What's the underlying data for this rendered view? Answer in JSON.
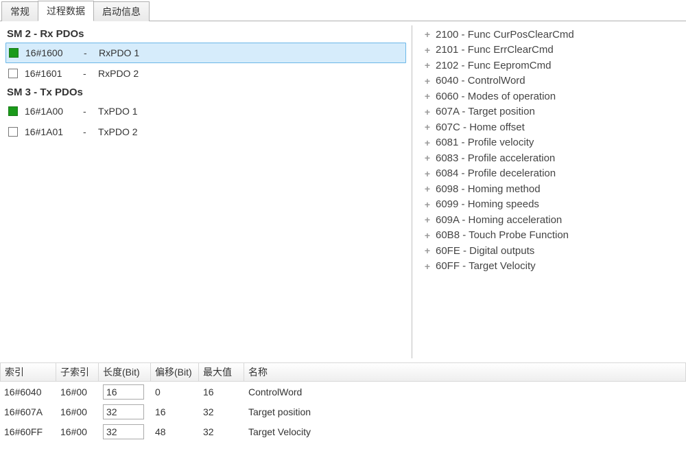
{
  "tabs": {
    "general": "常规",
    "process_data": "过程数据",
    "startup_info": "启动信息"
  },
  "active_tab": "process_data",
  "pdo_groups": [
    {
      "title": "SM 2 - Rx PDOs",
      "items": [
        {
          "checked": true,
          "selected": true,
          "index": "16#1600",
          "name": "RxPDO 1"
        },
        {
          "checked": false,
          "selected": false,
          "index": "16#1601",
          "name": "RxPDO 2"
        }
      ]
    },
    {
      "title": "SM 3 - Tx PDOs",
      "items": [
        {
          "checked": true,
          "selected": false,
          "index": "16#1A00",
          "name": "TxPDO 1"
        },
        {
          "checked": false,
          "selected": false,
          "index": "16#1A01",
          "name": "TxPDO 2"
        }
      ]
    }
  ],
  "objects": [
    "2100 - Func CurPosClearCmd",
    "2101 - Func ErrClearCmd",
    "2102 - Func EepromCmd",
    "6040 - ControlWord",
    "6060 - Modes of operation",
    "607A - Target position",
    "607C - Home offset",
    "6081 - Profile velocity",
    "6083 - Profile acceleration",
    "6084 - Profile deceleration",
    "6098 - Homing method",
    "6099 - Homing speeds",
    "609A - Homing acceleration",
    "60B8 - Touch Probe Function",
    "60FE - Digital outputs",
    "60FF - Target Velocity"
  ],
  "mapping_table": {
    "headers": {
      "index": "索引",
      "subindex": "子索引",
      "length_bit": "长度(Bit)",
      "offset_bit": "偏移(Bit)",
      "max": "最大值",
      "name": "名称"
    },
    "rows": [
      {
        "index": "16#6040",
        "subindex": "16#00",
        "length": "16",
        "offset": "0",
        "max": "16",
        "name": "ControlWord"
      },
      {
        "index": "16#607A",
        "subindex": "16#00",
        "length": "32",
        "offset": "16",
        "max": "32",
        "name": "Target position"
      },
      {
        "index": "16#60FF",
        "subindex": "16#00",
        "length": "32",
        "offset": "48",
        "max": "32",
        "name": "Target Velocity"
      }
    ]
  }
}
